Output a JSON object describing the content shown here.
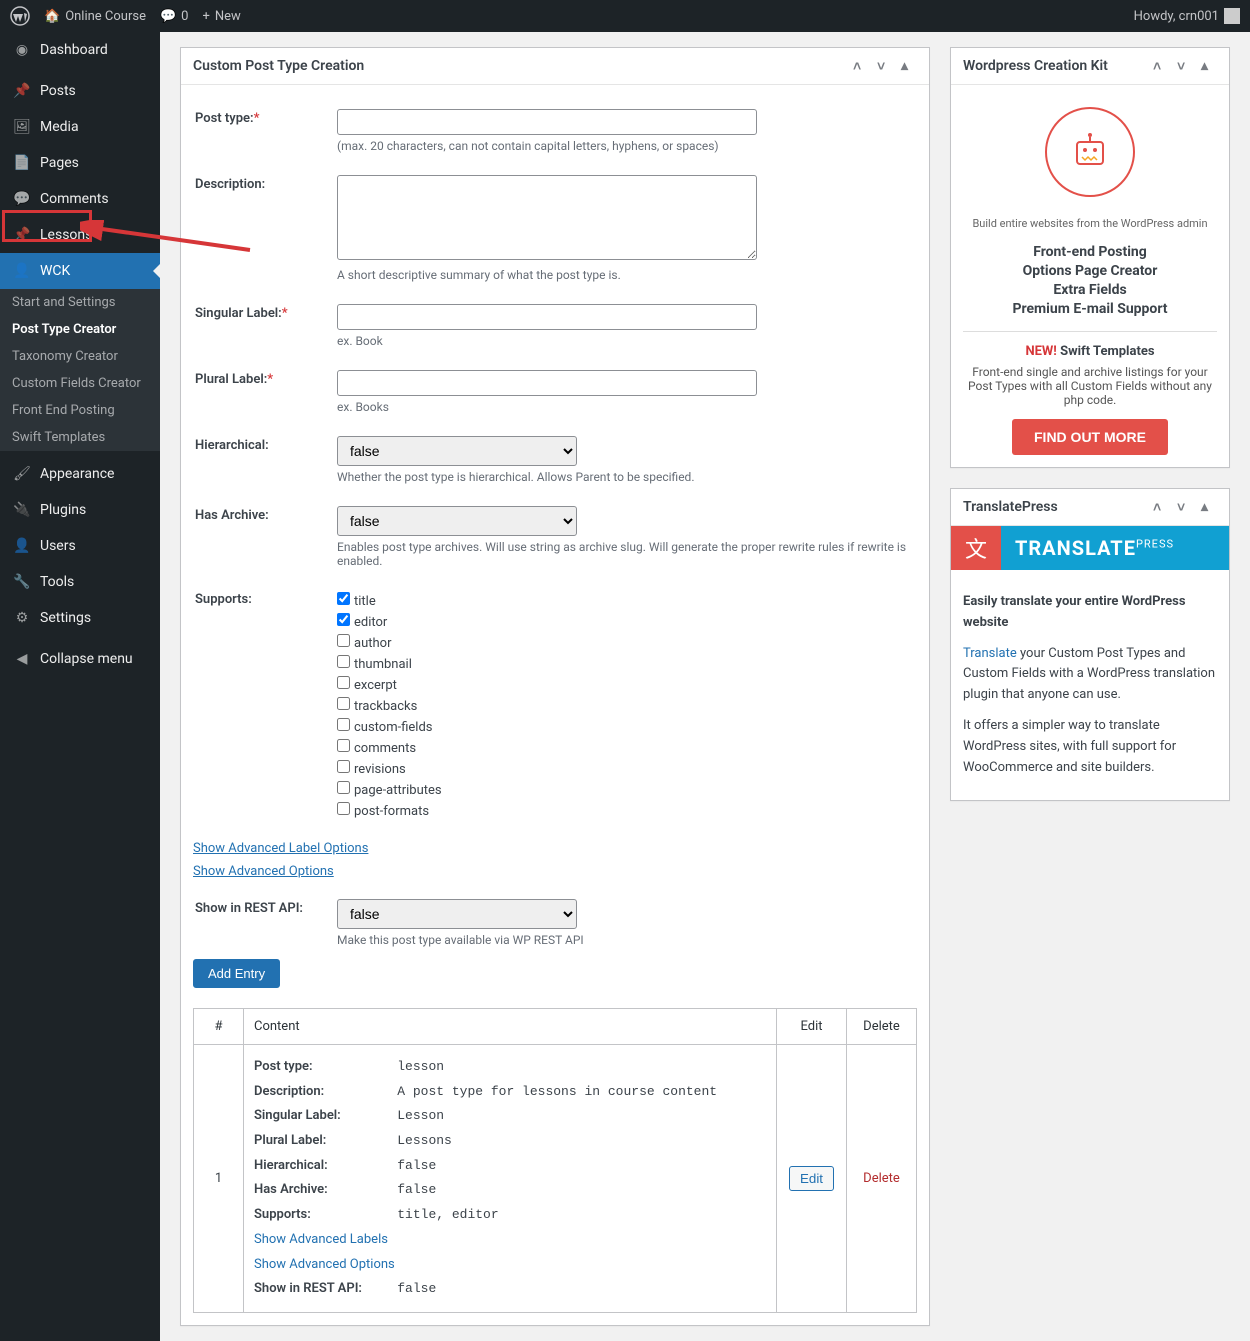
{
  "toolbar": {
    "site_name": "Online Course",
    "comments": "0",
    "new": "New",
    "howdy": "Howdy, crn001"
  },
  "sidebar": {
    "items": [
      {
        "icon": "dashboard",
        "label": "Dashboard"
      },
      {
        "icon": "pin",
        "label": "Posts"
      },
      {
        "icon": "media",
        "label": "Media"
      },
      {
        "icon": "page",
        "label": "Pages"
      },
      {
        "icon": "comment",
        "label": "Comments"
      },
      {
        "icon": "pin",
        "label": "Lessons"
      },
      {
        "icon": "user",
        "label": "WCK"
      }
    ],
    "submenu": [
      {
        "label": "Start and Settings"
      },
      {
        "label": "Post Type Creator",
        "active": true
      },
      {
        "label": "Taxonomy Creator"
      },
      {
        "label": "Custom Fields Creator"
      },
      {
        "label": "Front End Posting"
      },
      {
        "label": "Swift Templates"
      }
    ],
    "items2": [
      {
        "icon": "brush",
        "label": "Appearance"
      },
      {
        "icon": "plug",
        "label": "Plugins"
      },
      {
        "icon": "users",
        "label": "Users"
      },
      {
        "icon": "wrench",
        "label": "Tools"
      },
      {
        "icon": "settings",
        "label": "Settings"
      },
      {
        "icon": "collapse",
        "label": "Collapse menu"
      }
    ]
  },
  "main_box": {
    "title": "Custom Post Type Creation",
    "fields": {
      "post_type": {
        "label": "Post type:",
        "hint": "(max. 20 characters, can not contain capital letters, hyphens, or spaces)"
      },
      "description": {
        "label": "Description:",
        "hint": "A short descriptive summary of what the post type is."
      },
      "singular": {
        "label": "Singular Label:",
        "hint": "ex. Book"
      },
      "plural": {
        "label": "Plural Label:",
        "hint": "ex. Books"
      },
      "hierarchical": {
        "label": "Hierarchical:",
        "value": "false",
        "hint": "Whether the post type is hierarchical. Allows Parent to be specified."
      },
      "archive": {
        "label": "Has Archive:",
        "value": "false",
        "hint": "Enables post type archives. Will use string as archive slug. Will generate the proper rewrite rules if rewrite is enabled."
      },
      "supports": {
        "label": "Supports:",
        "options": [
          "title",
          "editor",
          "author",
          "thumbnail",
          "excerpt",
          "trackbacks",
          "custom-fields",
          "comments",
          "revisions",
          "page-attributes",
          "post-formats"
        ],
        "checked": [
          "title",
          "editor"
        ]
      },
      "adv_labels": "Show Advanced Label Options",
      "adv_opts": "Show Advanced Options",
      "rest": {
        "label": "Show in REST API:",
        "value": "false",
        "hint": "Make this post type available via WP REST API"
      },
      "add_btn": "Add Entry"
    },
    "table": {
      "headers": [
        "#",
        "Content",
        "Edit",
        "Delete"
      ],
      "row_num": "1",
      "entry": {
        "Post type:": "lesson",
        "Description:": "A post type for lessons in course content",
        "Singular Label:": "Lesson",
        "Plural Label:": "Lessons",
        "Hierarchical:": "false",
        "Has Archive:": "false",
        "Supports:": "title, editor",
        "Show in REST API:": "false"
      },
      "links": [
        "Show Advanced Labels",
        "Show Advanced Options"
      ],
      "edit": "Edit",
      "delete": "Delete"
    }
  },
  "wck": {
    "title": "Wordpress Creation Kit",
    "tagline": "Build entire websites from the WordPress admin",
    "features": [
      "Front-end Posting",
      "Options Page Creator",
      "Extra Fields",
      "Premium E-mail Support"
    ],
    "new": "NEW!",
    "swift": "Swift Templates",
    "swift_desc": "Front-end single and archive listings for your Post Types with all Custom Fields without any php code.",
    "btn": "FIND OUT MORE"
  },
  "tp": {
    "title": "TranslatePress",
    "banner": "TRANSLATE",
    "banner_sup": "PRESS",
    "headline": "Easily translate your entire WordPress website",
    "p1a": "Translate",
    "p1b": " your Custom Post Types and Custom Fields with a WordPress translation plugin that anyone can use.",
    "p2": "It offers a simpler way to translate WordPress sites, with full support for WooCommerce and site builders."
  }
}
